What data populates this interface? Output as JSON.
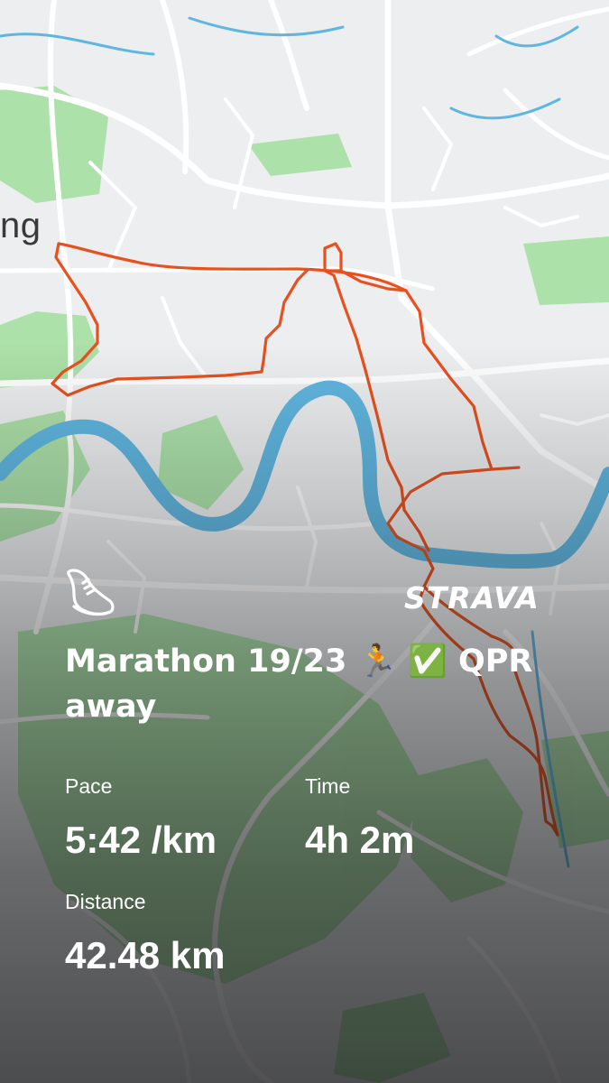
{
  "map": {
    "place_label": "ng",
    "route_color": "#e8501d",
    "water_color": "#3aa7d8",
    "park_color": "#9ddc9a",
    "road_color": "#ffffff"
  },
  "activity": {
    "icon": "running-shoe-icon",
    "title": "Marathon 19/23 🏃 ✅ QPR away",
    "brand": "STRAVA",
    "stats": {
      "pace": {
        "label": "Pace",
        "value": "5:42 /km"
      },
      "time": {
        "label": "Time",
        "value": "4h 2m"
      },
      "distance": {
        "label": "Distance",
        "value": "42.48 km"
      }
    }
  }
}
